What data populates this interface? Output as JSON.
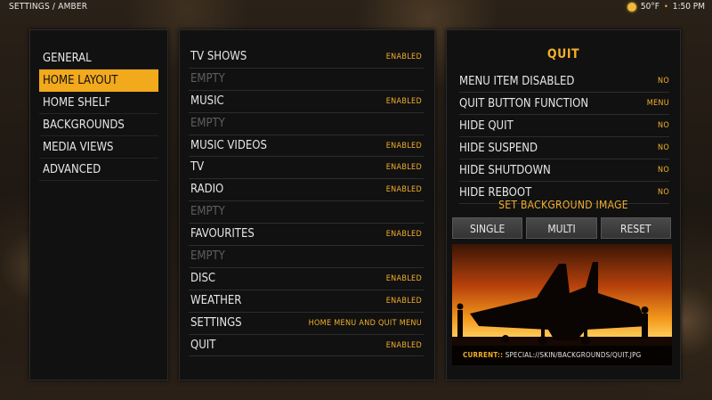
{
  "topbar": {
    "breadcrumb": "SETTINGS / AMBER",
    "temperature": "50°F",
    "separator": "•",
    "time": "1:50 PM"
  },
  "menu": {
    "items": [
      "GENERAL",
      "HOME LAYOUT",
      "HOME SHELF",
      "BACKGROUNDS",
      "MEDIA VIEWS",
      "ADVANCED"
    ],
    "active_index": 1
  },
  "home_items": [
    {
      "label": "TV SHOWS",
      "value": "ENABLED"
    },
    {
      "label": "EMPTY",
      "value": ""
    },
    {
      "label": "MUSIC",
      "value": "ENABLED"
    },
    {
      "label": "EMPTY",
      "value": ""
    },
    {
      "label": "MUSIC VIDEOS",
      "value": "ENABLED"
    },
    {
      "label": "TV",
      "value": "ENABLED"
    },
    {
      "label": "RADIO",
      "value": "ENABLED"
    },
    {
      "label": "EMPTY",
      "value": ""
    },
    {
      "label": "FAVOURITES",
      "value": "ENABLED"
    },
    {
      "label": "EMPTY",
      "value": ""
    },
    {
      "label": "DISC",
      "value": "ENABLED"
    },
    {
      "label": "WEATHER",
      "value": "ENABLED"
    },
    {
      "label": "SETTINGS",
      "value": "HOME MENU AND QUIT MENU"
    },
    {
      "label": "QUIT",
      "value": "ENABLED"
    }
  ],
  "quit_panel": {
    "title": "QUIT",
    "options": [
      {
        "label": "MENU ITEM DISABLED",
        "value": "NO"
      },
      {
        "label": "QUIT BUTTON FUNCTION",
        "value": "MENU"
      },
      {
        "label": "HIDE QUIT",
        "value": "NO"
      },
      {
        "label": "HIDE SUSPEND",
        "value": "NO"
      },
      {
        "label": "HIDE SHUTDOWN",
        "value": "NO"
      },
      {
        "label": "HIDE REBOOT",
        "value": "NO"
      }
    ],
    "set_background_title": "SET BACKGROUND IMAGE",
    "buttons": {
      "single": "SINGLE",
      "multi": "MULTI",
      "reset": "RESET"
    },
    "current_label": "CURRENT::",
    "current_path": "SPECIAL://SKIN/BACKGROUNDS/QUIT.JPG"
  },
  "colors": {
    "accent": "#f2a91c",
    "text": "#e6e6e6",
    "empty_text": "#5e5e5e"
  },
  "icons": {
    "weather": "sun-icon"
  }
}
